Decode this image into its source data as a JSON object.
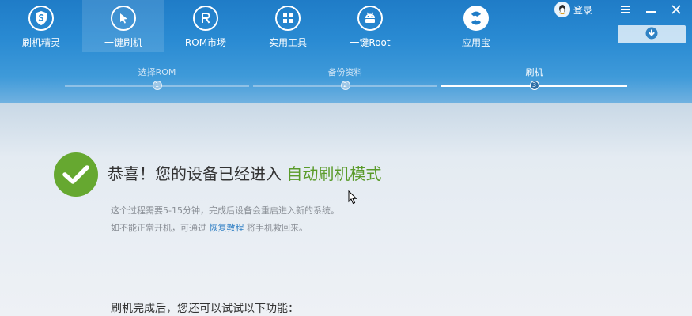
{
  "nav": {
    "items": [
      {
        "label": "刷机精灵",
        "icon": "shield-s-icon"
      },
      {
        "label": "一键刷机",
        "icon": "arrow-cursor-icon",
        "active": true
      },
      {
        "label": "ROM市场",
        "icon": "rom-r-icon"
      },
      {
        "label": "实用工具",
        "icon": "grid-tools-icon"
      },
      {
        "label": "一键Root",
        "icon": "android-robot-icon"
      }
    ],
    "appstore": {
      "label": "应用宝",
      "icon": "appstore-logo-icon"
    }
  },
  "window": {
    "login_label": "登录",
    "login_icon": "qq-penguin-icon",
    "controls": [
      "menu-icon",
      "minimize-icon",
      "close-icon"
    ],
    "download_icon": "download-icon"
  },
  "steps": [
    {
      "label": "选择ROM",
      "number": "1"
    },
    {
      "label": "备份资料",
      "number": "2"
    },
    {
      "label": "刷机",
      "number": "3",
      "current": true
    }
  ],
  "content": {
    "headline_prefix": "恭喜！您的设备已经进入 ",
    "headline_highlight": "自动刷机模式",
    "desc1": "这个过程需要5-15分钟，完成后设备会重启进入新的系统。",
    "desc2_prefix": "如不能正常开机，可通过 ",
    "desc2_link": "恢复教程",
    "desc2_suffix": " 将手机救回来。",
    "after_label": "刷机完成后，您还可以试试以下功能："
  },
  "colors": {
    "header_blue": "#2a8bd3",
    "success_green": "#66a830",
    "highlight_green": "#5a9b2a",
    "link_blue": "#2f7fc4"
  }
}
